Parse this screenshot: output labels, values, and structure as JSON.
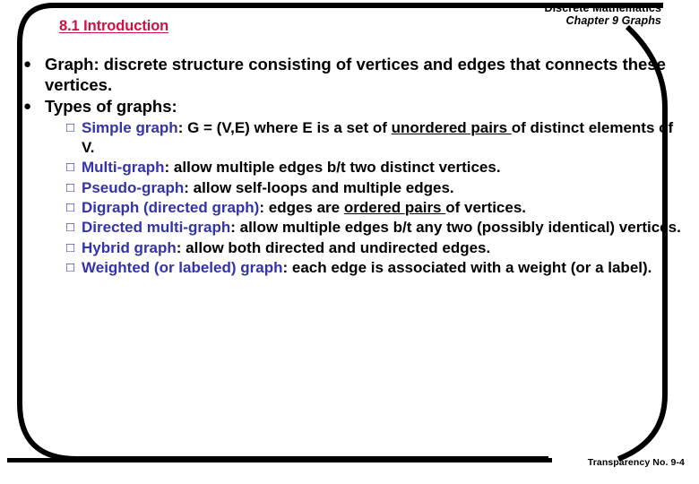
{
  "header": {
    "course": "Discrete Mathematics",
    "chapter": "Chapter 9 Graphs"
  },
  "title": "8.1 Introduction",
  "colors": {
    "title": "#cc1144",
    "term": "#3333aa",
    "body": "#000000",
    "frame": "#000000",
    "background": "#ffffff"
  },
  "markers": {
    "level1": "●",
    "level2": "□"
  },
  "bullets": [
    {
      "marker_name": "filled-circle-bullet",
      "text": "Graph: discrete structure consisting of vertices and edges that connects these vertices."
    },
    {
      "marker_name": "filled-circle-bullet",
      "text": "Types of graphs:"
    }
  ],
  "subbullets": [
    {
      "marker_name": "hollow-square-bullet",
      "term": "Simple graph",
      "rest_1": ": G = (V,E) where E is a set of ",
      "underlined_1": "unordered pairs ",
      "rest_2": "of distinct elements of V.",
      "plain": ": G = (V,E) where E is a set of unordered pairs of distinct elements of V."
    },
    {
      "marker_name": "hollow-square-bullet",
      "term": "Multi-graph",
      "rest_1": ": allow multiple edges b/t two distinct vertices.",
      "underlined_1": "",
      "rest_2": "",
      "plain": ": allow multiple edges b/t two distinct vertices."
    },
    {
      "marker_name": "hollow-square-bullet",
      "term": "Pseudo-graph",
      "rest_1": ": allow self-loops and multiple edges.",
      "underlined_1": "",
      "rest_2": "",
      "plain": ": allow self-loops and multiple edges."
    },
    {
      "marker_name": "hollow-square-bullet",
      "term": "Digraph (directed graph)",
      "rest_1": ": edges are ",
      "underlined_1": "ordered pairs ",
      "rest_2": "of vertices.",
      "plain": ": edges are ordered pairs of vertices."
    },
    {
      "marker_name": "hollow-square-bullet",
      "term": "Directed multi-graph",
      "rest_1": ": allow multiple edges b/t any two (possibly identical) vertices.",
      "underlined_1": "",
      "rest_2": "",
      "plain": ": allow multiple edges b/t any two (possibly identical) vertices."
    },
    {
      "marker_name": "hollow-square-bullet",
      "term": "Hybrid graph",
      "rest_1": ": allow both directed and undirected edges.",
      "underlined_1": "",
      "rest_2": "",
      "plain": ": allow both directed and undirected edges."
    },
    {
      "marker_name": "hollow-square-bullet",
      "term": "Weighted (or labeled) graph",
      "rest_1": ": each edge is associated with a weight (or a label).",
      "underlined_1": "",
      "rest_2": "",
      "plain": ": each edge is associated with a weight (or a label)."
    }
  ],
  "footer": {
    "text": "Transparency No. 9-4"
  }
}
